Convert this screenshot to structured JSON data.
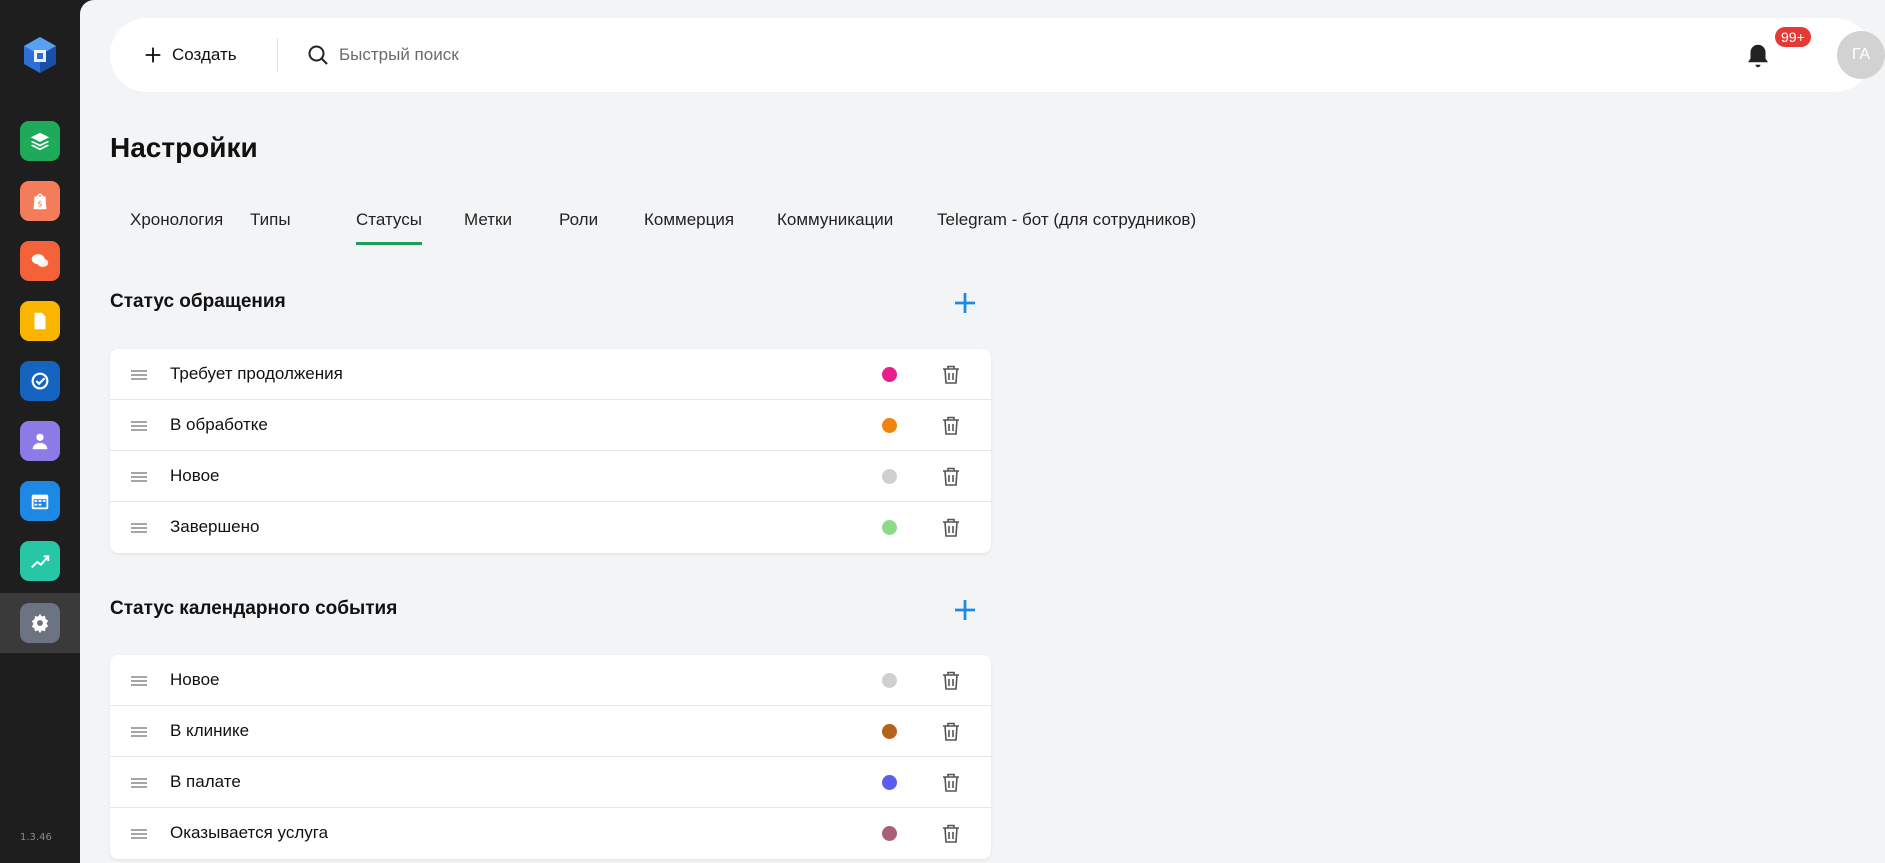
{
  "app": {
    "version": "1.3.46"
  },
  "sidebar": {
    "apps": [
      {
        "icon": "layers-icon",
        "color": "#1faa59"
      },
      {
        "icon": "shopping-bag-dollar-icon",
        "color": "#f47c5a"
      },
      {
        "icon": "chat-bubbles-icon",
        "color": "#f4623a"
      },
      {
        "icon": "document-icon",
        "color": "#f9b500"
      },
      {
        "icon": "check-circle-icon",
        "color": "#1565c0"
      },
      {
        "icon": "user-icon",
        "color": "#8c7ae6"
      },
      {
        "icon": "calendar-icon",
        "color": "#1e88e5"
      },
      {
        "icon": "chart-up-icon",
        "color": "#26c6a6"
      },
      {
        "icon": "gear-icon",
        "color": "#6b7480"
      }
    ]
  },
  "header": {
    "create_label": "Создать",
    "search_placeholder": "Быстрый поиск",
    "notifications_badge": "99+",
    "avatar_initials": "ГА"
  },
  "page": {
    "title": "Настройки"
  },
  "tabs": [
    {
      "label": "Хронология",
      "active": false
    },
    {
      "label": "Типы",
      "active": false
    },
    {
      "label": "Статусы",
      "active": true
    },
    {
      "label": "Метки",
      "active": false
    },
    {
      "label": "Роли",
      "active": false
    },
    {
      "label": "Коммерция",
      "active": false
    },
    {
      "label": "Коммуникации",
      "active": false
    },
    {
      "label": "Telegram - бот (для сотрудников)",
      "active": false
    }
  ],
  "sections": [
    {
      "title": "Статус обращения",
      "items": [
        {
          "label": "Требует продолжения",
          "color": "#e91e8c"
        },
        {
          "label": "В обработке",
          "color": "#f0820f"
        },
        {
          "label": "Новое",
          "color": "#cfcfcf"
        },
        {
          "label": "Завершено",
          "color": "#8fd98a"
        }
      ]
    },
    {
      "title": "Статус календарного события",
      "items": [
        {
          "label": "Новое",
          "color": "#cfcfcf"
        },
        {
          "label": "В клинике",
          "color": "#b5621a"
        },
        {
          "label": "В палате",
          "color": "#5b5bf0"
        },
        {
          "label": "Оказывается услуга",
          "color": "#a8607a"
        }
      ]
    }
  ],
  "colors": {
    "accent": "#1e9e5a",
    "add_icon": "#1e88e5",
    "badge": "#e53935"
  }
}
